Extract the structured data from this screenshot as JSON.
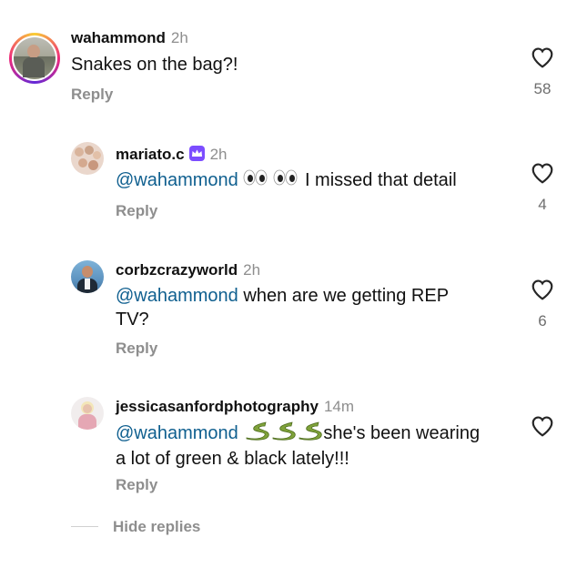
{
  "comments": [
    {
      "username": "wahammond",
      "time": "2h",
      "text": "Snakes on the bag?!",
      "reply_label": "Reply",
      "likes": "58"
    },
    {
      "username": "mariato.c",
      "time": "2h",
      "mention": "@wahammond",
      "text": "I missed that detail",
      "reply_label": "Reply",
      "likes": "4",
      "emojis": "eyes eyes"
    },
    {
      "username": "corbzcrazyworld",
      "time": "2h",
      "mention": "@wahammond",
      "text_line1": "when are we getting REP",
      "text_line2": "TV?",
      "reply_label": "Reply",
      "likes": "6"
    },
    {
      "username": "jessicasanfordphotography",
      "time": "14m",
      "mention": "@wahammond",
      "text_line1": "she's been wearing",
      "text_line2": "a lot of green & black lately!!!",
      "reply_label": "Reply",
      "likes": "",
      "emojis": "snake snake snake"
    }
  ],
  "hide_replies_label": "Hide replies",
  "colors": {
    "mention": "#0f5f8f",
    "secondary_text": "#8e8e8e",
    "verified_badge": "#7c4dff"
  },
  "icons": [
    "heart-icon",
    "eyes-emoji",
    "snake-emoji",
    "crown-badge-icon"
  ]
}
